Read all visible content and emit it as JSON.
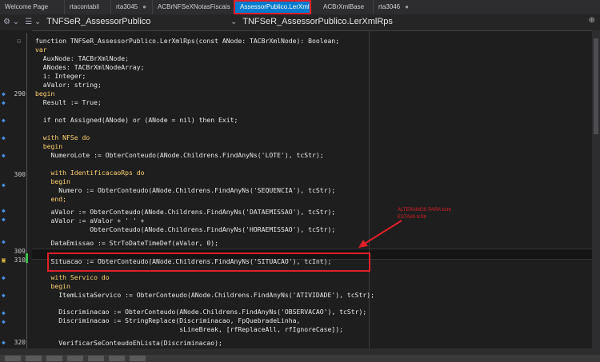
{
  "tabs": [
    {
      "label": "Welcome Page",
      "close": ""
    },
    {
      "label": "rtacontabil",
      "close": ""
    },
    {
      "label": "rta3045",
      "close": "●"
    },
    {
      "label": "ACBrNFSeXNotasFiscais",
      "close": ""
    },
    {
      "label": "AssessorPublico.LerXml",
      "close": ""
    },
    {
      "label": "ACBrXmlBase",
      "close": ""
    },
    {
      "label": "rta3046",
      "close": "●"
    }
  ],
  "nav": {
    "left": "TNFSeR_AssessorPublico",
    "middle": "TNFSeR_AssessorPublico.LerXmlRps"
  },
  "annotation": {
    "line1": "ALTERAMOS PARA tcInt",
    "line2": "ESTAVA tcStr"
  },
  "gutter": [
    "290",
    "300",
    "309",
    "310",
    "320"
  ],
  "code": [
    "function TNFSeR_AssessorPublico.LerXmlRps(const ANode: TACBrXmlNode): Boolean;",
    "var",
    "  AuxNode: TACBrXmlNode;",
    "  ANodes: TACBrXmlNodeArray;",
    "  i: Integer;",
    "  aValor: string;",
    "begin",
    "  Result := True;",
    "",
    "  if not Assigned(ANode) or (ANode = nil) then Exit;",
    "",
    "  with NFSe do",
    "  begin",
    "    NumeroLote := ObterConteudo(ANode.Childrens.FindAnyNs('LOTE'), tcStr);",
    "",
    "    with IdentificacaoRps do",
    "    begin",
    "      Numero := ObterConteudo(ANode.Childrens.FindAnyNs('SEQUENCIA'), tcStr);",
    "    end;",
    "",
    "    aValor := ObterConteudo(ANode.Childrens.FindAnyNs('DATAEMISSAO'), tcStr);",
    "    aValor := aValor + ' ' +",
    "              ObterConteudo(ANode.Childrens.FindAnyNs('HORAEMISSAO'), tcStr);",
    "",
    "    DataEmissao := StrToDateTimeDef(aValor, 0);",
    "",
    "    Situacao := ObterConteudo(ANode.Childrens.FindAnyNs('SITUACAO'), tcInt);",
    "",
    "    with Servico do",
    "    begin",
    "      ItemListaServico := ObterConteudo(ANode.Childrens.FindAnyNs('ATIVIDADE'), tcStr);",
    "",
    "      Discriminacao := ObterConteudo(ANode.Childrens.FindAnyNs('OBSERVACAO'), tcStr);",
    "      Discriminacao := StringReplace(Discriminacao, FpQuebradeLinha,",
    "                                     sLineBreak, [rfReplaceAll, rfIgnoreCase]);",
    "",
    "      VerificarSeConteudoEhLista(Discriminacao);"
  ]
}
